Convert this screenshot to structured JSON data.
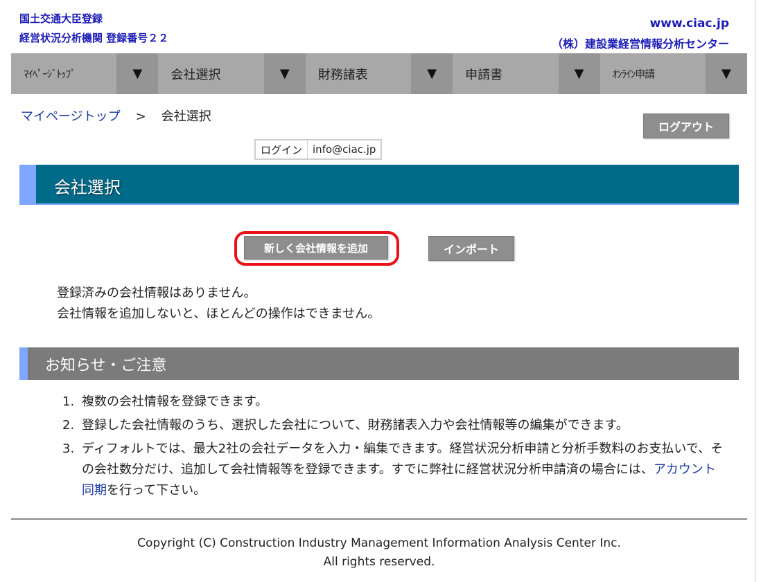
{
  "header": {
    "registration_line1": "国土交通大臣登録",
    "registration_line2": "経営状況分析機関 登録番号２２",
    "site_url": "www.ciac.jp",
    "company_name": "（株）建設業経営情報分析センター"
  },
  "nav": {
    "items": [
      {
        "label": "ﾏｲﾍﾟｰｼﾞﾄｯﾌﾟ"
      },
      {
        "label": "会社選択"
      },
      {
        "label": "財務諸表"
      },
      {
        "label": "申請書"
      },
      {
        "label": "ｵﾝﾗｲﾝ申請"
      }
    ],
    "arrow": "▼"
  },
  "breadcrumb": {
    "home": "マイページトップ",
    "separator": ">",
    "current": "会社選択"
  },
  "logout_label": "ログアウト",
  "login": {
    "label": "ログイン",
    "email": "info@ciac.jp"
  },
  "section_title": "会社選択",
  "buttons": {
    "add_company": "新しく会社情報を追加",
    "import": "インポート"
  },
  "messages": {
    "line1": "登録済みの会社情報はありません。",
    "line2": "会社情報を追加しないと、ほとんどの操作はできません。"
  },
  "notice": {
    "title": "お知らせ・ご注意",
    "items": [
      {
        "num": "1.",
        "text": "複数の会社情報を登録できます。"
      },
      {
        "num": "2.",
        "text": "登録した会社情報のうち、選択した会社について、財務諸表入力や会社情報等の編集ができます。"
      },
      {
        "num": "3.",
        "text_before": "ディフォルトでは、最大2社の会社データを入力・編集できます。経営状況分析申請と分析手数料のお支払いで、その会社数分だけ、追加して会社情報等を登録できます。すでに弊社に経営状況分析申請済の場合には、",
        "link": "アカウント同期",
        "text_after": "を行って下さい。"
      }
    ]
  },
  "footer": {
    "copyright_line1": "Copyright (C) Construction Industry Management Information Analysis Center Inc.",
    "copyright_line2": "All rights reserved."
  },
  "colors": {
    "header_text": "#1c1cb4",
    "nav_bg": "#a8a8a8",
    "section_title_bg": "#006a89",
    "accent_bar": "#7fa7ff",
    "notice_bg": "#7b7b7b",
    "button_bg": "#8e8e8e",
    "highlight_ring": "#e8131a",
    "link": "#1c3ca0"
  }
}
